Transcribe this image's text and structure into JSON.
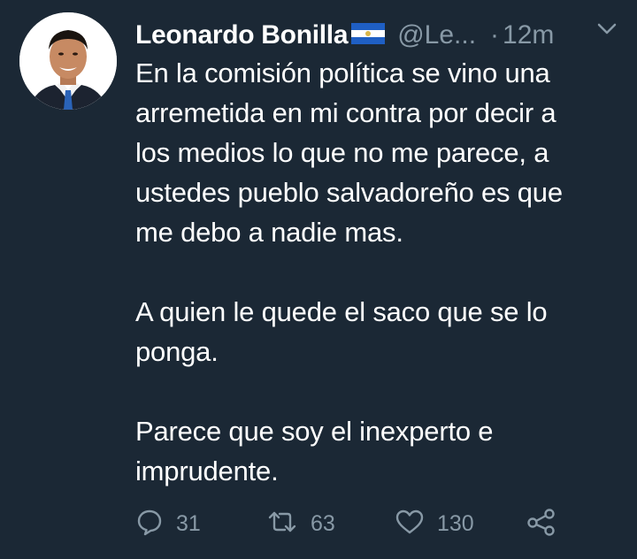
{
  "tweet": {
    "display_name": "Leonardo Bonilla",
    "handle": "@Le...",
    "separator": "·",
    "time": "12m",
    "paragraphs": [
      "En la comisión política se vino una\narremetida en mi contra por decir a\nlos medios lo que no me parece, a\nustedes pueblo salvadoreño es que\nme debo a nadie mas.",
      "A quien le quede el saco que se lo\nponga.",
      "Parece que soy el inexperto e\nimprudente."
    ]
  },
  "actions": {
    "reply_count": "31",
    "retweet_count": "63",
    "like_count": "130"
  },
  "icons": {
    "flag": "el-salvador-flag-icon",
    "chevron": "chevron-down-icon",
    "reply": "reply-icon",
    "retweet": "retweet-icon",
    "like": "heart-icon",
    "share": "share-icon"
  },
  "colors": {
    "background": "#1b2835",
    "text": "#ffffff",
    "secondary_text": "#8899a6",
    "flag_blue": "#1f5fc4"
  }
}
